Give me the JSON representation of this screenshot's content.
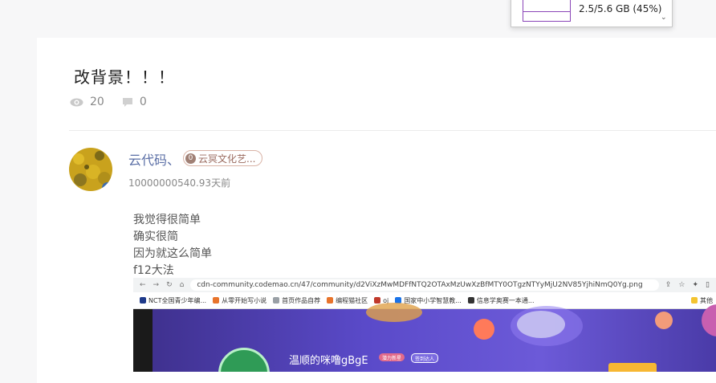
{
  "post": {
    "title": "改背景！！！",
    "views": "20",
    "comments": "0"
  },
  "comment": {
    "author": "云代码、",
    "badge_icon": "0",
    "badge_label": "云冥文化艺...",
    "time": "10000000540.93天前",
    "lines": [
      "我觉得很简单",
      "确实很简",
      "因为就这么简单",
      "f12大法"
    ]
  },
  "screenshot": {
    "url": "cdn-community.codemao.cn/47/community/d2ViXzMwMDFfNTQ2OTAxMzUwXzBfMTY0OTgzNTYyMjU2NV85YjhiNmQ0Yg.png",
    "bookmarks": [
      "NCT全国青少年编...",
      "从零开始写小说",
      "首页作品自荐",
      "编程猫社区",
      "oj",
      "国家中小学智慧教...",
      "信息学奥赛一本通..."
    ],
    "bookmark_more": "其他",
    "profile_name": "温顺的咪噜gBgE",
    "chip1": "潜力新星",
    "chip2": "签到达人"
  },
  "memory_popup": {
    "text": "2.5/5.6 GB (45%)",
    "chevron": "⌄"
  }
}
